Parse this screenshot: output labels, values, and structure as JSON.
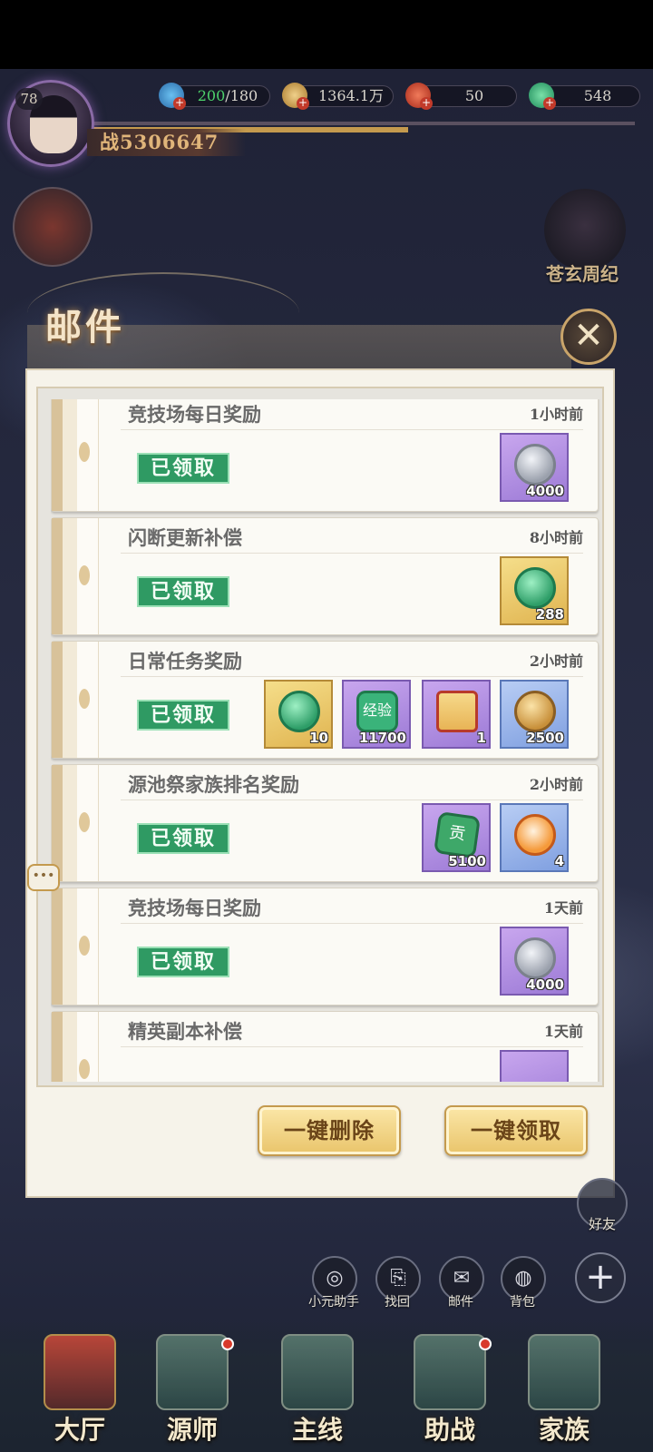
{
  "hud": {
    "level": "78",
    "power": "战5306647",
    "resources": [
      {
        "icon": "stamina-icon",
        "current": "200",
        "max": "/180"
      },
      {
        "icon": "copper-coin-icon",
        "value": "1364.1万"
      },
      {
        "icon": "red-gem-icon",
        "value": "50"
      },
      {
        "icon": "jade-icon",
        "value": "548"
      }
    ]
  },
  "side_right_label": "苍玄周纪",
  "dialog": {
    "title": "邮件",
    "close": "✕",
    "claimed_label": "已领取",
    "delete_all": "一键删除",
    "claim_all": "一键领取"
  },
  "mails": [
    {
      "title": "竞技场每日奖励",
      "time": "1小时前",
      "items": [
        {
          "icon": "silver-coin-icon",
          "count": "4000"
        }
      ]
    },
    {
      "title": "闪断更新补偿",
      "time": "8小时前",
      "items": [
        {
          "icon": "jade-ring-icon",
          "count": "288"
        }
      ]
    },
    {
      "title": "日常任务奖励",
      "time": "2小时前",
      "items": [
        {
          "icon": "jade-ring-icon",
          "count": "10"
        },
        {
          "icon": "exp-icon",
          "count": "11700",
          "text": "经验"
        },
        {
          "icon": "scroll-icon",
          "count": "1"
        },
        {
          "icon": "copper-coin-icon",
          "count": "2500"
        }
      ]
    },
    {
      "title": "源池祭家族排名奖励",
      "time": "2小时前",
      "items": [
        {
          "icon": "contribution-icon",
          "count": "5100",
          "text": "贡"
        },
        {
          "icon": "fox-pet-icon",
          "count": "4"
        }
      ]
    },
    {
      "title": "竞技场每日奖励",
      "time": "1天前",
      "items": [
        {
          "icon": "silver-coin-icon",
          "count": "4000"
        }
      ]
    },
    {
      "title": "精英副本补偿",
      "time": "1天前",
      "items": []
    }
  ],
  "right_rail": {
    "friend_label": "好友"
  },
  "quick_actions": [
    {
      "icon": "assistant-icon",
      "label": "小元助手"
    },
    {
      "icon": "recall-icon",
      "label": "找回"
    },
    {
      "icon": "mail-icon",
      "label": "邮件"
    },
    {
      "icon": "bag-icon",
      "label": "背包"
    }
  ],
  "plus": "+",
  "nav": [
    {
      "label": "大厅"
    },
    {
      "label": "源师"
    },
    {
      "label": "主线"
    },
    {
      "label": "助战"
    },
    {
      "label": "家族"
    }
  ],
  "chat_bubble": "•••"
}
